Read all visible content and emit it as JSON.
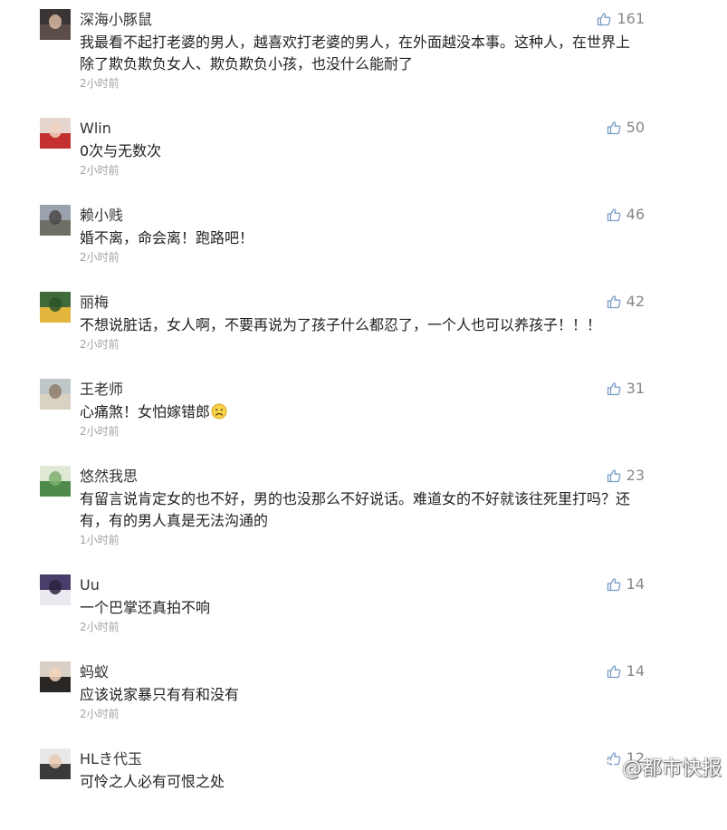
{
  "comments": [
    {
      "user": "深海小豚鼠",
      "text": "我最看不起打老婆的男人，越喜欢打老婆的男人，在外面越没本事。这种人，在世界上除了欺负欺负女人、欺负欺负小孩，也没什么能耐了",
      "time": "2小时前",
      "likes": "161",
      "avatar": [
        "#3a3434",
        "#5b4e49",
        "#d9b9a1"
      ]
    },
    {
      "user": "Wlin",
      "text": "0次与无数次",
      "time": "2小时前",
      "likes": "50",
      "avatar": [
        "#e7d6cf",
        "#c42f2f",
        "#f1d2bf"
      ]
    },
    {
      "user": "赖小贱",
      "text": "婚不离，命会离！跑路吧！",
      "time": "2小时前",
      "likes": "46",
      "avatar": [
        "#9aa3ad",
        "#6e6f64",
        "#4b4a48"
      ]
    },
    {
      "user": "丽梅",
      "text": "不想说脏话，女人啊，不要再说为了孩子什么都忍了，一个人也可以养孩子！！！",
      "time": "2小时前",
      "likes": "42",
      "avatar": [
        "#3f6a3a",
        "#e2b63d",
        "#2e5229"
      ]
    },
    {
      "user": "王老师",
      "text": "心痛煞！女怕嫁错郎",
      "time": "2小时前",
      "likes": "31",
      "emoji": "sad-face",
      "avatar": [
        "#bfc7c9",
        "#d9d2c3",
        "#8e7c6d"
      ]
    },
    {
      "user": "悠然我思",
      "text": "有留言说肯定女的也不好，男的也没那么不好说话。难道女的不好就该往死里打吗？还有，有的男人真是无法沟通的",
      "time": "1小时前",
      "likes": "23",
      "avatar": [
        "#dfe9d6",
        "#4e8a4a",
        "#7fb06f"
      ]
    },
    {
      "user": "Uu",
      "text": "一个巴掌还真拍不响",
      "time": "2小时前",
      "likes": "14",
      "avatar": [
        "#4a3d6b",
        "#e9e9ef",
        "#2b2340"
      ]
    },
    {
      "user": "蚂蚁",
      "text": "应该说家暴只有有和没有",
      "time": "2小时前",
      "likes": "14",
      "avatar": [
        "#d8cfc6",
        "#2a2624",
        "#f2d3bc"
      ]
    },
    {
      "user": "HLき代玉",
      "text": "可怜之人必有可恨之处",
      "time": "",
      "likes": "12",
      "avatar": [
        "#e8e8e8",
        "#3a3a3a",
        "#e9cbb5"
      ]
    }
  ],
  "watermark": {
    "text": "@都市快报",
    "icon": "weibo-icon"
  },
  "colors": {
    "username": "#333333",
    "text": "#222222",
    "time": "#a3a3a3",
    "likes": "#888888",
    "thumb": "#7a9cc6"
  }
}
